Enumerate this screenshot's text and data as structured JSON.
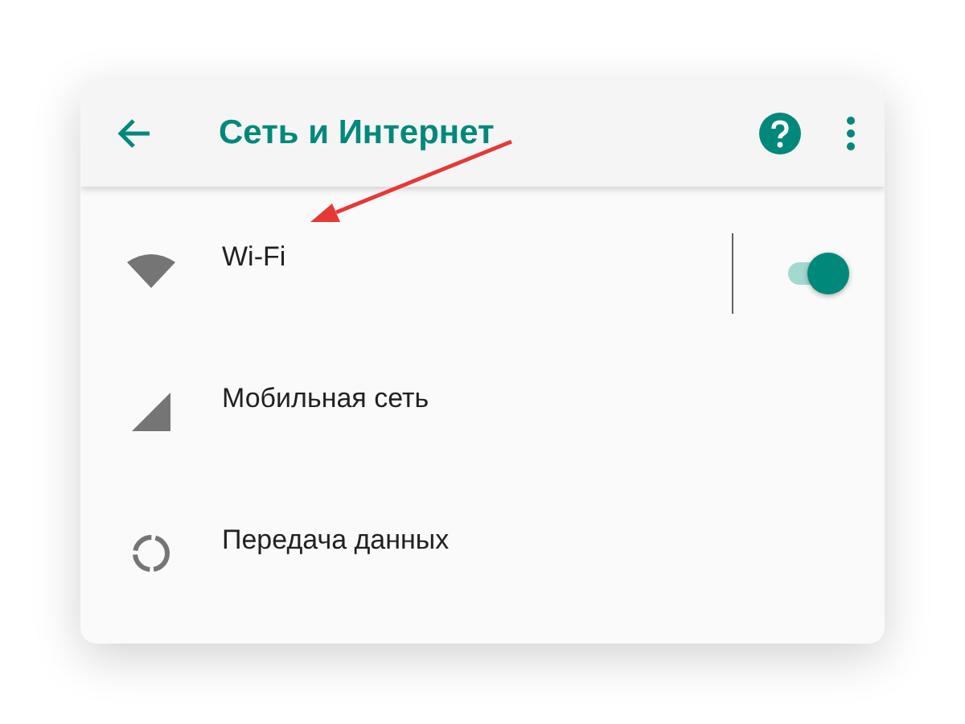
{
  "app_bar": {
    "title": "Сеть и Интернет"
  },
  "items": [
    {
      "kind": "toggle",
      "label": "Wi-Fi",
      "on": true
    },
    {
      "kind": "plain",
      "label": "Мобильная сеть"
    },
    {
      "kind": "plain",
      "label": "Передача данных"
    }
  ]
}
